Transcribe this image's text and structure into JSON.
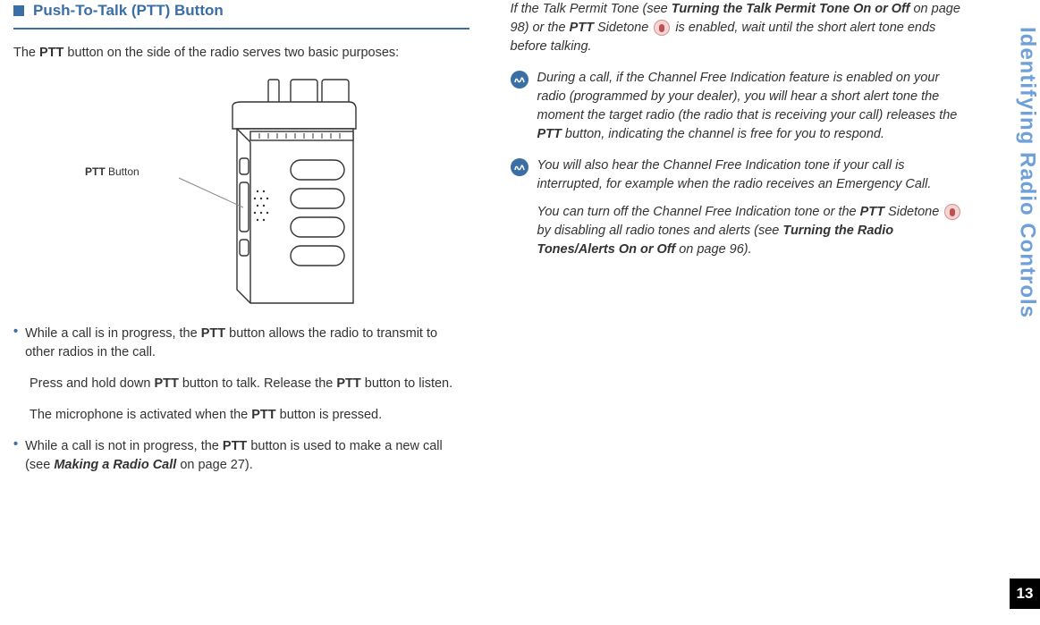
{
  "sidebar": {
    "title": "Identifying Radio Controls",
    "pageNum": "13"
  },
  "left": {
    "heading": "Push-To-Talk (PTT) Button",
    "intro1": "The ",
    "intro2": "PTT",
    "intro3": " button on the side of the radio serves two basic purposes:",
    "pttLabel1": "PTT",
    "pttLabel2": " Button",
    "bullet1a": "While a call is in progress, the ",
    "bullet1b": "PTT",
    "bullet1c": " button allows the radio to transmit to other radios in the call.",
    "sub1a": "Press and hold down ",
    "sub1b": "PTT",
    "sub1c": " button to talk. Release the ",
    "sub1d": "PTT",
    "sub1e": " button to listen.",
    "sub2a": "The microphone is activated when the ",
    "sub2b": "PTT",
    "sub2c": " button is pressed.",
    "bullet2a": "While a call is not in progress, the ",
    "bullet2b": "PTT",
    "bullet2c": " button is used to make a new call (see ",
    "bullet2d": "Making a Radio Call",
    "bullet2e": " on page 27)."
  },
  "right": {
    "p1a": "If the Talk Permit Tone (see ",
    "p1b": "Turning the Talk Permit Tone On or Off",
    "p1c": " on page 98) or the ",
    "p1d": "PTT",
    "p1e": " Sidetone ",
    "p1f": " is enabled, wait until the short alert tone ends before talking.",
    "note1a": "During a call, if the Channel Free Indication feature is enabled on your radio (programmed by your dealer), you will hear a short alert tone the moment the target radio (the radio that is receiving your call) releases the ",
    "note1b": "PTT",
    "note1c": " button, indicating the channel is free for you to respond.",
    "note2a": "You will also hear the Channel Free Indication tone if your call is interrupted, for example when the radio receives an Emergency Call.",
    "note3a": "You can turn off the Channel Free Indication tone or the ",
    "note3b": "PTT",
    "note3c": " Sidetone ",
    "note3d": " by disabling all radio tones and alerts (see ",
    "note3e": "Turning the Radio Tones/Alerts On or Off",
    "note3f": " on page 96)."
  }
}
